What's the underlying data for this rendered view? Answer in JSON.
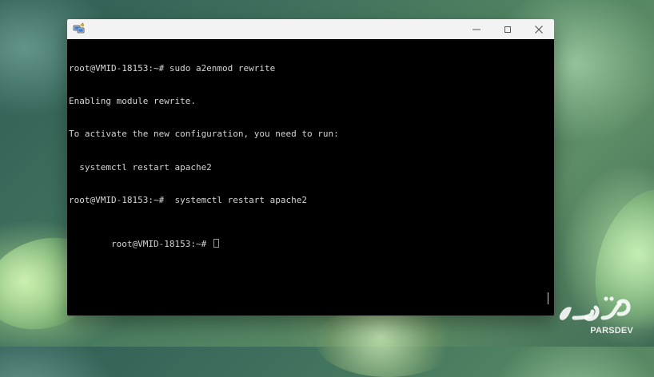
{
  "desktop": {
    "colors": {
      "base": "#4f8261",
      "accent_leaf": "#b9e8a6"
    }
  },
  "terminal": {
    "colors": {
      "background": "#000000",
      "foreground": "#d5d5d5",
      "cursor": "#38d84b"
    },
    "lines": [
      "root@VMID-18153:~# sudo a2enmod rewrite",
      "Enabling module rewrite.",
      "To activate the new configuration, you need to run:",
      "  systemctl restart apache2",
      "root@VMID-18153:~#  systemctl restart apache2",
      "root@VMID-18153:~# "
    ]
  },
  "window": {
    "icon": "putty-icon",
    "controls": {
      "minimize": "minimize-icon",
      "maximize": "maximize-icon",
      "close": "close-icon"
    }
  },
  "watermark": {
    "label": "PARSDEV"
  }
}
